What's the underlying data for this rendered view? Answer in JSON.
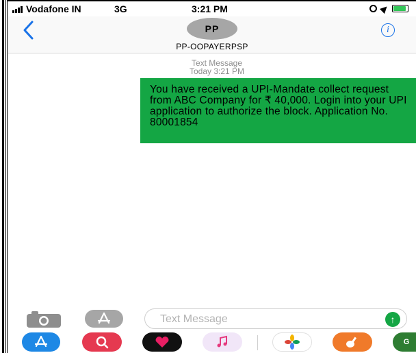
{
  "status_bar": {
    "carrier": "Vodafone IN",
    "network": "3G",
    "time": "3:21 PM"
  },
  "header": {
    "avatar_initials": "PP",
    "contact_name": "PP-OOPAYERPSP",
    "info_glyph": "i"
  },
  "thread": {
    "meta_label": "Text Message",
    "meta_time": "Today 3:21 PM",
    "messages": [
      {
        "text": "You have received a UPI-Mandate collect request from ABC Company for ₹ 40,000. Login into your UPI application to authorize the block. Application No. 80001854",
        "color": "#14a644"
      }
    ]
  },
  "compose": {
    "placeholder": "Text Message",
    "send_glyph": "↑"
  },
  "app_drawer": {
    "apps": [
      {
        "icon": "app-store-icon",
        "color": "#1e88e5"
      },
      {
        "icon": "search-images-icon",
        "color": "#e53950"
      },
      {
        "icon": "heart-digital-touch-icon",
        "color": "#111111"
      },
      {
        "icon": "music-icon",
        "color": "#f1e6f8"
      },
      {
        "icon": "photos-icon",
        "color": "#ffffff"
      },
      {
        "icon": "garageband-icon",
        "color": "#f07a2a"
      },
      {
        "icon": "gpay-icon",
        "color": "#2e7d32"
      }
    ]
  }
}
